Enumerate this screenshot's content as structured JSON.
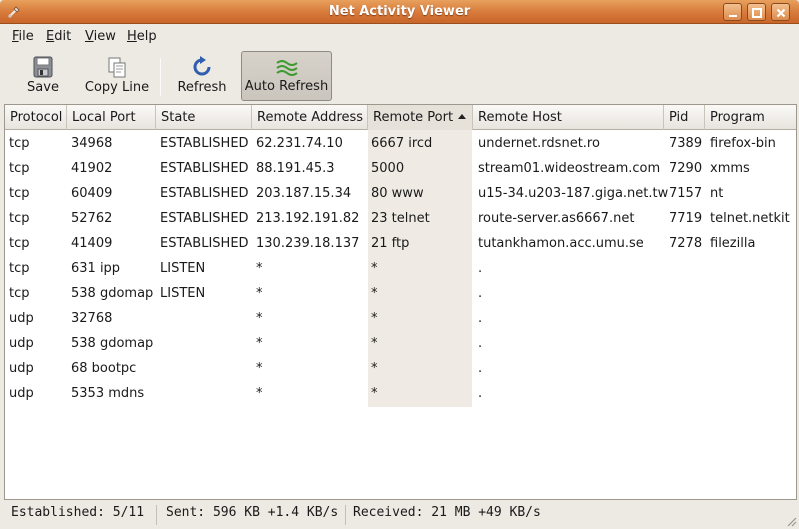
{
  "window": {
    "title": "Net Activity Viewer"
  },
  "menu": {
    "file": {
      "mnemonic": "F",
      "rest": "ile"
    },
    "edit": {
      "mnemonic": "E",
      "rest": "dit"
    },
    "view": {
      "mnemonic": "V",
      "rest": "iew"
    },
    "help": {
      "mnemonic": "H",
      "rest": "elp"
    }
  },
  "toolbar": {
    "save": "Save",
    "copy_line": "Copy Line",
    "refresh": "Refresh",
    "auto_refresh": "Auto Refresh",
    "auto_refresh_active": true
  },
  "table": {
    "columns": [
      "Protocol",
      "Local Port",
      "State",
      "Remote Address",
      "Remote Port",
      "Remote Host",
      "Pid",
      "Program"
    ],
    "sorted_column": "Remote Port",
    "rows": [
      [
        "tcp",
        "34968",
        "ESTABLISHED",
        "62.231.74.10",
        "6667 ircd",
        "undernet.rdsnet.ro",
        "7389",
        "firefox-bin"
      ],
      [
        "tcp",
        "41902",
        "ESTABLISHED",
        "88.191.45.3",
        "5000",
        "stream01.wideostream.com",
        "7290",
        "xmms"
      ],
      [
        "tcp",
        "60409",
        "ESTABLISHED",
        "203.187.15.34",
        "80 www",
        "u15-34.u203-187.giga.net.tw",
        "7157",
        "nt"
      ],
      [
        "tcp",
        "52762",
        "ESTABLISHED",
        "213.192.191.82",
        "23 telnet",
        "route-server.as6667.net",
        "7719",
        "telnet.netkit"
      ],
      [
        "tcp",
        "41409",
        "ESTABLISHED",
        "130.239.18.137",
        "21 ftp",
        "tutankhamon.acc.umu.se",
        "7278",
        "filezilla"
      ],
      [
        "tcp",
        "631 ipp",
        "LISTEN",
        "*",
        "*",
        ".",
        "",
        ""
      ],
      [
        "tcp",
        "538 gdomap",
        "LISTEN",
        "*",
        "*",
        ".",
        "",
        ""
      ],
      [
        "udp",
        "32768",
        "",
        "*",
        "*",
        ".",
        "",
        ""
      ],
      [
        "udp",
        "538 gdomap",
        "",
        "*",
        "*",
        ".",
        "",
        ""
      ],
      [
        "udp",
        "68 bootpc",
        "",
        "*",
        "*",
        ".",
        "",
        ""
      ],
      [
        "udp",
        "5353 mdns",
        "",
        "*",
        "*",
        ".",
        "",
        ""
      ]
    ]
  },
  "status": {
    "established": "Established: 5/11",
    "sent": "Sent: 596 KB +1.4 KB/s",
    "received": "Received: 21 MB +49 KB/s"
  },
  "colors": {
    "titlebar": "#d7793a",
    "sorted_column_bg": "#efebe4"
  }
}
